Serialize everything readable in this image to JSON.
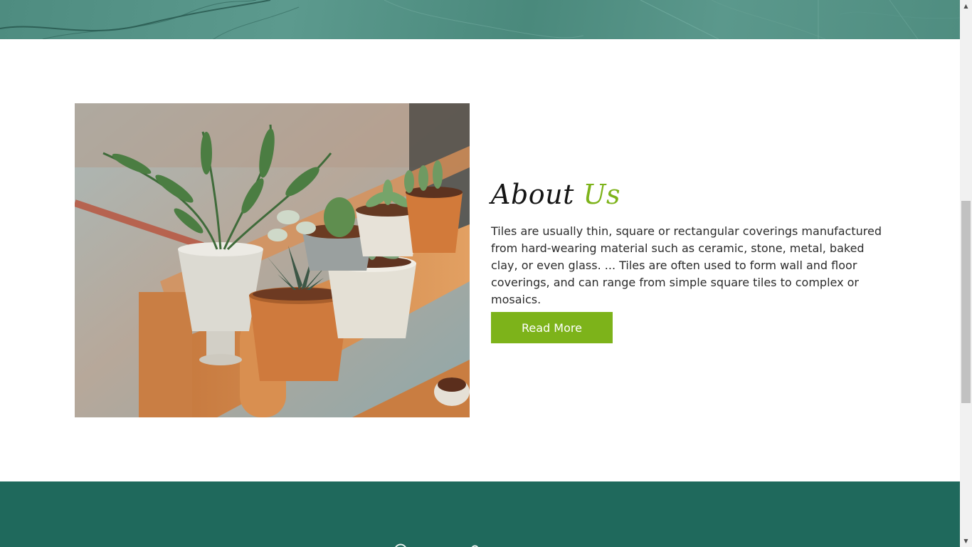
{
  "about": {
    "heading_main": "About",
    "heading_accent": "Us",
    "paragraph": "Tiles are usually thin, square or rectangular coverings manufactured from hard-wearing material such as ceramic, stone, metal, baked clay, or even glass. ... Tiles are often used to form wall and floor coverings, and can range from simple square tiles to complex or mosaics.",
    "button_label": "Read More"
  },
  "colors": {
    "accent": "#7db31a",
    "banner_teal": "#4f8d80",
    "footer_teal": "#1f695c",
    "heading": "#151515"
  },
  "icons": {
    "scroll_up": "triangle-up-icon",
    "scroll_down": "triangle-down-icon"
  }
}
